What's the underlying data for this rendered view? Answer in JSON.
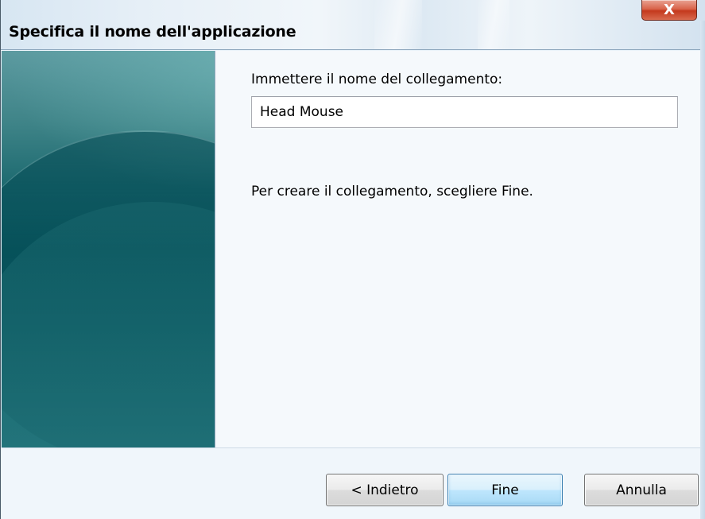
{
  "window": {
    "title": "Specifica il nome dell'applicazione",
    "close_glyph": "X"
  },
  "form": {
    "prompt_label": "Immettere il nome del collegamento:",
    "name_value": "Head Mouse",
    "hint": "Per creare il collegamento, scegliere Fine."
  },
  "buttons": {
    "back": "< Indietro",
    "finish": "Fine",
    "cancel": "Annulla"
  },
  "colors": {
    "panel_teal": "#0c5a62",
    "close_red": "#c4391d",
    "default_button_border": "#3c7fb1"
  }
}
